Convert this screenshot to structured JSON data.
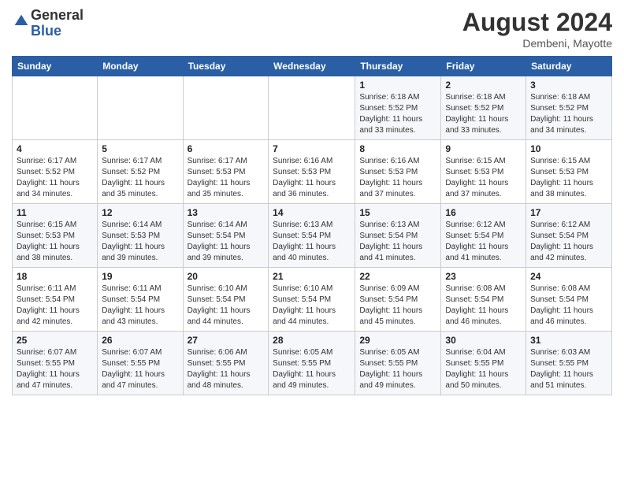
{
  "header": {
    "logo_line1": "General",
    "logo_line2": "Blue",
    "month_year": "August 2024",
    "location": "Dembeni, Mayotte"
  },
  "days_of_week": [
    "Sunday",
    "Monday",
    "Tuesday",
    "Wednesday",
    "Thursday",
    "Friday",
    "Saturday"
  ],
  "weeks": [
    [
      {
        "day": "",
        "info": ""
      },
      {
        "day": "",
        "info": ""
      },
      {
        "day": "",
        "info": ""
      },
      {
        "day": "",
        "info": ""
      },
      {
        "day": "1",
        "info": "Sunrise: 6:18 AM\nSunset: 5:52 PM\nDaylight: 11 hours\nand 33 minutes."
      },
      {
        "day": "2",
        "info": "Sunrise: 6:18 AM\nSunset: 5:52 PM\nDaylight: 11 hours\nand 33 minutes."
      },
      {
        "day": "3",
        "info": "Sunrise: 6:18 AM\nSunset: 5:52 PM\nDaylight: 11 hours\nand 34 minutes."
      }
    ],
    [
      {
        "day": "4",
        "info": "Sunrise: 6:17 AM\nSunset: 5:52 PM\nDaylight: 11 hours\nand 34 minutes."
      },
      {
        "day": "5",
        "info": "Sunrise: 6:17 AM\nSunset: 5:52 PM\nDaylight: 11 hours\nand 35 minutes."
      },
      {
        "day": "6",
        "info": "Sunrise: 6:17 AM\nSunset: 5:53 PM\nDaylight: 11 hours\nand 35 minutes."
      },
      {
        "day": "7",
        "info": "Sunrise: 6:16 AM\nSunset: 5:53 PM\nDaylight: 11 hours\nand 36 minutes."
      },
      {
        "day": "8",
        "info": "Sunrise: 6:16 AM\nSunset: 5:53 PM\nDaylight: 11 hours\nand 37 minutes."
      },
      {
        "day": "9",
        "info": "Sunrise: 6:15 AM\nSunset: 5:53 PM\nDaylight: 11 hours\nand 37 minutes."
      },
      {
        "day": "10",
        "info": "Sunrise: 6:15 AM\nSunset: 5:53 PM\nDaylight: 11 hours\nand 38 minutes."
      }
    ],
    [
      {
        "day": "11",
        "info": "Sunrise: 6:15 AM\nSunset: 5:53 PM\nDaylight: 11 hours\nand 38 minutes."
      },
      {
        "day": "12",
        "info": "Sunrise: 6:14 AM\nSunset: 5:53 PM\nDaylight: 11 hours\nand 39 minutes."
      },
      {
        "day": "13",
        "info": "Sunrise: 6:14 AM\nSunset: 5:54 PM\nDaylight: 11 hours\nand 39 minutes."
      },
      {
        "day": "14",
        "info": "Sunrise: 6:13 AM\nSunset: 5:54 PM\nDaylight: 11 hours\nand 40 minutes."
      },
      {
        "day": "15",
        "info": "Sunrise: 6:13 AM\nSunset: 5:54 PM\nDaylight: 11 hours\nand 41 minutes."
      },
      {
        "day": "16",
        "info": "Sunrise: 6:12 AM\nSunset: 5:54 PM\nDaylight: 11 hours\nand 41 minutes."
      },
      {
        "day": "17",
        "info": "Sunrise: 6:12 AM\nSunset: 5:54 PM\nDaylight: 11 hours\nand 42 minutes."
      }
    ],
    [
      {
        "day": "18",
        "info": "Sunrise: 6:11 AM\nSunset: 5:54 PM\nDaylight: 11 hours\nand 42 minutes."
      },
      {
        "day": "19",
        "info": "Sunrise: 6:11 AM\nSunset: 5:54 PM\nDaylight: 11 hours\nand 43 minutes."
      },
      {
        "day": "20",
        "info": "Sunrise: 6:10 AM\nSunset: 5:54 PM\nDaylight: 11 hours\nand 44 minutes."
      },
      {
        "day": "21",
        "info": "Sunrise: 6:10 AM\nSunset: 5:54 PM\nDaylight: 11 hours\nand 44 minutes."
      },
      {
        "day": "22",
        "info": "Sunrise: 6:09 AM\nSunset: 5:54 PM\nDaylight: 11 hours\nand 45 minutes."
      },
      {
        "day": "23",
        "info": "Sunrise: 6:08 AM\nSunset: 5:54 PM\nDaylight: 11 hours\nand 46 minutes."
      },
      {
        "day": "24",
        "info": "Sunrise: 6:08 AM\nSunset: 5:54 PM\nDaylight: 11 hours\nand 46 minutes."
      }
    ],
    [
      {
        "day": "25",
        "info": "Sunrise: 6:07 AM\nSunset: 5:55 PM\nDaylight: 11 hours\nand 47 minutes."
      },
      {
        "day": "26",
        "info": "Sunrise: 6:07 AM\nSunset: 5:55 PM\nDaylight: 11 hours\nand 47 minutes."
      },
      {
        "day": "27",
        "info": "Sunrise: 6:06 AM\nSunset: 5:55 PM\nDaylight: 11 hours\nand 48 minutes."
      },
      {
        "day": "28",
        "info": "Sunrise: 6:05 AM\nSunset: 5:55 PM\nDaylight: 11 hours\nand 49 minutes."
      },
      {
        "day": "29",
        "info": "Sunrise: 6:05 AM\nSunset: 5:55 PM\nDaylight: 11 hours\nand 49 minutes."
      },
      {
        "day": "30",
        "info": "Sunrise: 6:04 AM\nSunset: 5:55 PM\nDaylight: 11 hours\nand 50 minutes."
      },
      {
        "day": "31",
        "info": "Sunrise: 6:03 AM\nSunset: 5:55 PM\nDaylight: 11 hours\nand 51 minutes."
      }
    ]
  ]
}
